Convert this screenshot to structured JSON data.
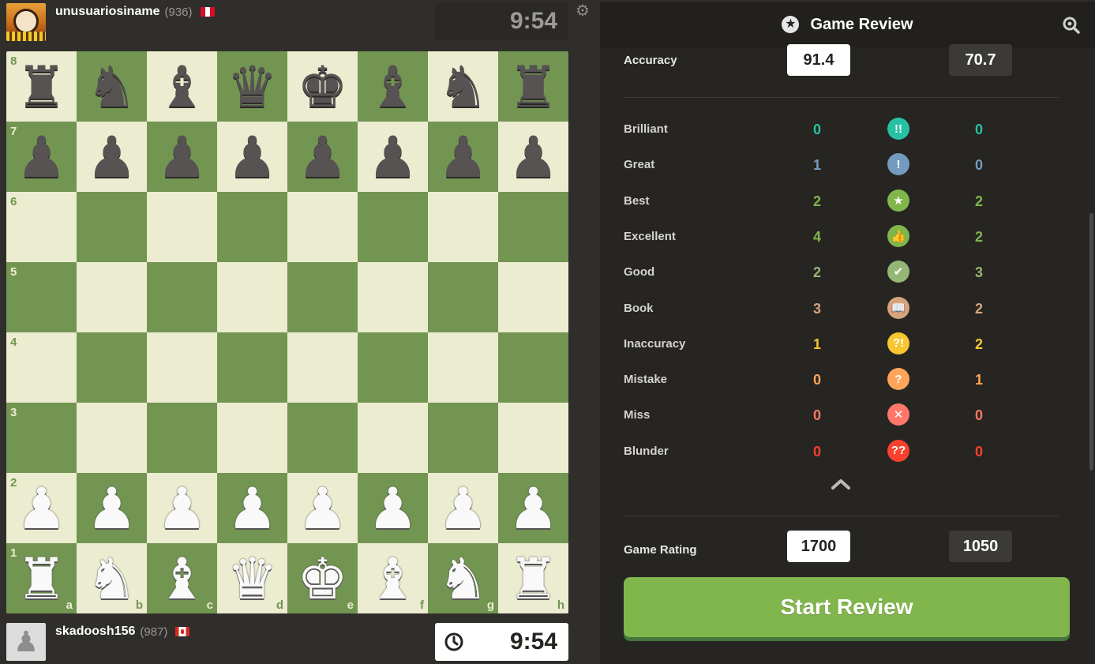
{
  "top_player": {
    "name": "unusuariosiname",
    "rating": "(936)",
    "clock": "9:54",
    "flag": "peru-flag"
  },
  "bottom_player": {
    "name": "skadoosh156",
    "rating": "(987)",
    "clock": "9:54",
    "flag": "canada-flag"
  },
  "board": {
    "light_color": "#ebecd0",
    "dark_color": "#739552",
    "ranks": [
      "8",
      "7",
      "6",
      "5",
      "4",
      "3",
      "2",
      "1"
    ],
    "files": [
      "a",
      "b",
      "c",
      "d",
      "e",
      "f",
      "g",
      "h"
    ],
    "rows": [
      [
        "br",
        "bn",
        "bb",
        "bq",
        "bk",
        "bb",
        "bn",
        "br"
      ],
      [
        "bp",
        "bp",
        "bp",
        "bp",
        "bp",
        "bp",
        "bp",
        "bp"
      ],
      [
        "",
        "",
        "",
        "",
        "",
        "",
        "",
        ""
      ],
      [
        "",
        "",
        "",
        "",
        "",
        "",
        "",
        ""
      ],
      [
        "",
        "",
        "",
        "",
        "",
        "",
        "",
        ""
      ],
      [
        "",
        "",
        "",
        "",
        "",
        "",
        "",
        ""
      ],
      [
        "wp",
        "wp",
        "wp",
        "wp",
        "wp",
        "wp",
        "wp",
        "wp"
      ],
      [
        "wr",
        "wn",
        "wb",
        "wq",
        "wk",
        "wb",
        "wn",
        "wr"
      ]
    ]
  },
  "review": {
    "title": "Game Review",
    "accuracy_label": "Accuracy",
    "accuracy_white": "91.4",
    "accuracy_black": "70.7",
    "classifications": [
      {
        "label": "Brilliant",
        "white": "0",
        "black": "0",
        "icon": "brilliant-icon",
        "symbol": "!!",
        "color": "#26c2a3"
      },
      {
        "label": "Great",
        "white": "1",
        "black": "0",
        "icon": "great-icon",
        "symbol": "!",
        "color": "#749bbf"
      },
      {
        "label": "Best",
        "white": "2",
        "black": "2",
        "icon": "best-icon",
        "symbol": "★",
        "color": "#81b64c"
      },
      {
        "label": "Excellent",
        "white": "4",
        "black": "2",
        "icon": "excellent-icon",
        "symbol": "👍",
        "color": "#81b64c"
      },
      {
        "label": "Good",
        "white": "2",
        "black": "3",
        "icon": "good-icon",
        "symbol": "✔",
        "color": "#95b776"
      },
      {
        "label": "Book",
        "white": "3",
        "black": "2",
        "icon": "book-icon",
        "symbol": "📖",
        "color": "#d5a47d"
      },
      {
        "label": "Inaccuracy",
        "white": "1",
        "black": "2",
        "icon": "inaccuracy-icon",
        "symbol": "?!",
        "color": "#f7c631"
      },
      {
        "label": "Mistake",
        "white": "0",
        "black": "1",
        "icon": "mistake-icon",
        "symbol": "?",
        "color": "#ffa459"
      },
      {
        "label": "Miss",
        "white": "0",
        "black": "0",
        "icon": "miss-icon",
        "symbol": "✕",
        "color": "#ff7769"
      },
      {
        "label": "Blunder",
        "white": "0",
        "black": "0",
        "icon": "blunder-icon",
        "symbol": "??",
        "color": "#fa412d"
      }
    ],
    "game_rating_label": "Game Rating",
    "game_rating_white": "1700",
    "game_rating_black": "1050",
    "start_button": "Start Review"
  }
}
